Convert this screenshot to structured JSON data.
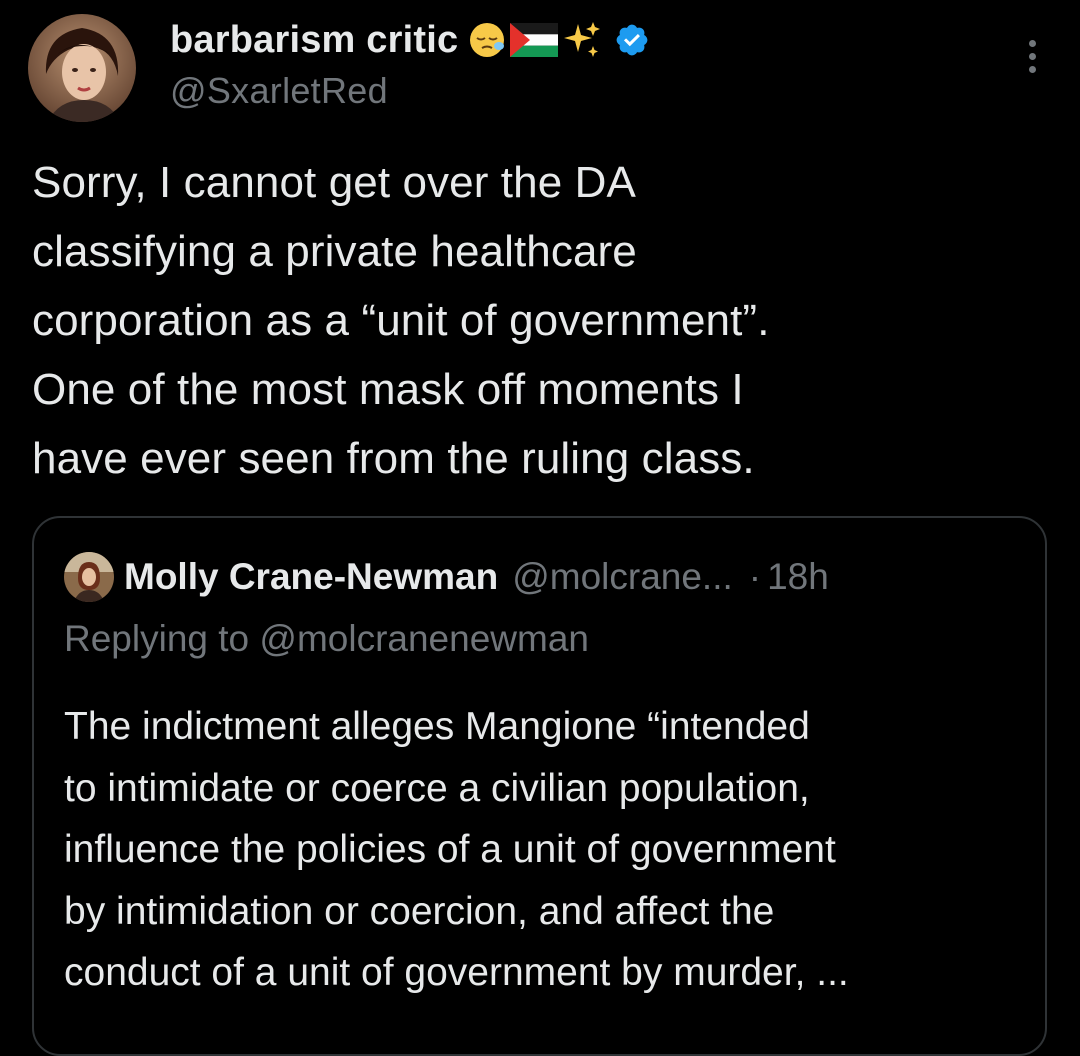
{
  "tweet": {
    "author": {
      "display_name": "barbarism critic",
      "name_emojis": [
        "sleepy-face-emoji",
        "palestine-flag-emoji",
        "sparkles-emoji"
      ],
      "verified": true,
      "handle": "@SxarletRed"
    },
    "menu_icon": "more-vertical-icon",
    "text_lines": [
      "Sorry, I cannot get over the DA",
      "classifying a private healthcare",
      "corporation as a “unit of government”.",
      "One of the most mask off moments I",
      "have ever seen from the ruling class."
    ]
  },
  "quoted_tweet": {
    "author": {
      "display_name": "Molly Crane-Newman",
      "handle": "@molcrane...",
      "separator": "·",
      "time": "18h"
    },
    "replying_to": "Replying to @molcranenewman",
    "text_lines": [
      "The indictment alleges Mangione “intended",
      "to intimidate or coerce a civilian population,",
      "influence the policies of a unit of government",
      "by intimidation or coercion, and affect the",
      "conduct of a unit of government by murder, ..."
    ]
  },
  "colors": {
    "background": "#000000",
    "primary_text": "#e7e9ea",
    "secondary_text": "#71767b",
    "border": "#2f3336",
    "verified_blue": "#1d9bf0"
  }
}
